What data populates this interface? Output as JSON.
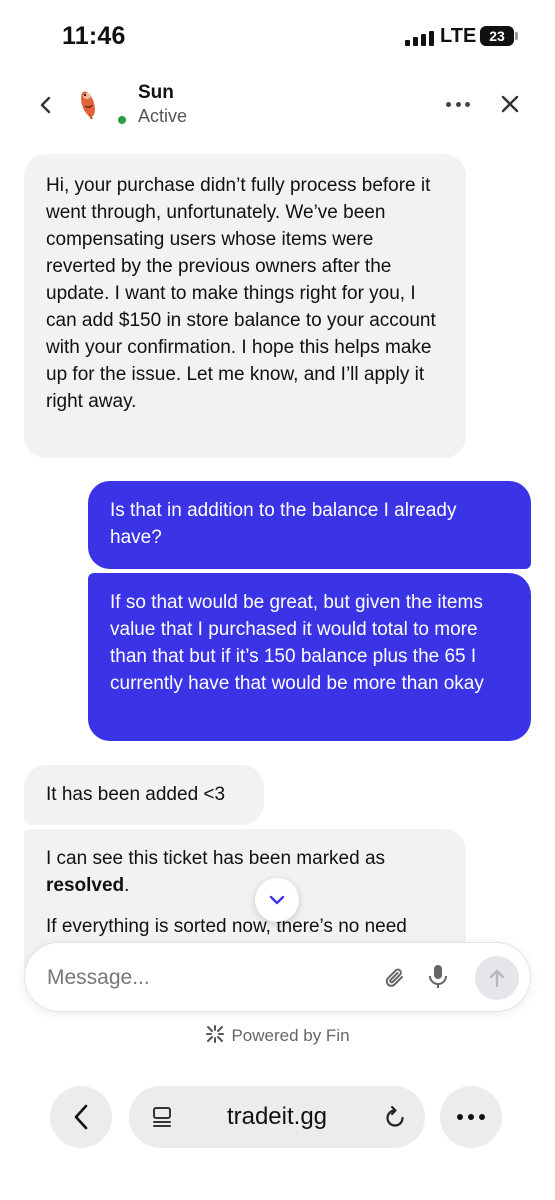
{
  "status_bar": {
    "time": "11:46",
    "network": "LTE",
    "battery": "23"
  },
  "header": {
    "agent_name": "Sun",
    "agent_status": "Active",
    "status_color": "#2e9b44"
  },
  "messages": [
    {
      "sender": "agent",
      "paragraphs": [
        "Hi, your purchase didn’t fully process before it went through, unfortunately. We’ve been compensating users whose items were reverted by the previous owners after the update. I want to make things right for you, I can add $150 in store balance to your account with your confirmation. I hope this helps make up for the issue. Let me know, and I’ll apply it right away."
      ]
    },
    {
      "sender": "user",
      "paragraphs": [
        "Is that in addition to the balance I already have?"
      ]
    },
    {
      "sender": "user",
      "paragraphs": [
        "If so that would be great, but given the items value that I purchased it would total to more than that but if it’s 150 balance plus the 65 I currently have that would be more than okay"
      ]
    },
    {
      "sender": "agent",
      "paragraphs": [
        "It has been added <3"
      ]
    },
    {
      "sender": "agent",
      "paragraphs": [
        "I can see this ticket has been marked as",
        "resolved",
        ".",
        "If everything is sorted now, there’s no need"
      ]
    }
  ],
  "composer": {
    "placeholder": "Message..."
  },
  "powered_by": "Powered by Fin",
  "browser": {
    "url": "tradeit.gg"
  },
  "colors": {
    "user_bubble": "#3b34e6",
    "agent_bubble": "#f2f2f4"
  },
  "icons": [
    "back-icon",
    "chat-back-icon",
    "more-icon",
    "close-icon",
    "chevron-down-icon",
    "attach-icon",
    "mic-icon",
    "send-arrow-icon",
    "fin-icon",
    "tabs-icon",
    "reload-icon"
  ]
}
